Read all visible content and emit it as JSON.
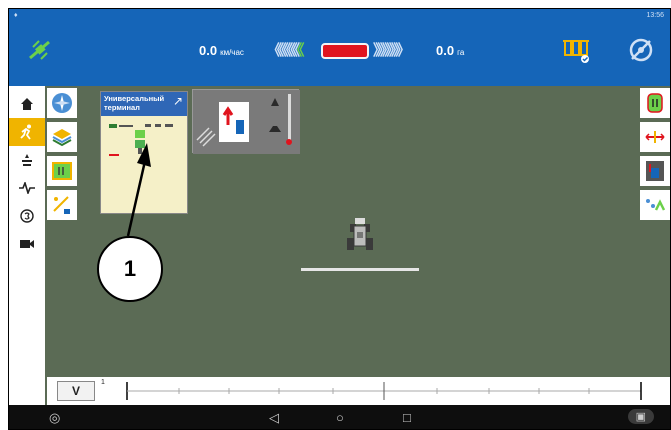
{
  "status_bar": {
    "left_icon": "signal-icon",
    "time": "13:56"
  },
  "top_bar": {
    "speed_left": {
      "value": "0.0",
      "unit": "км/час"
    },
    "speed_right": {
      "value": "0.0",
      "unit": "га"
    },
    "chevrons_left": "《《《《《",
    "chevrons_left_active": "《",
    "chevrons_right": "》》》》》》",
    "center_indicator_color": "#e0141e"
  },
  "left_nav": [
    {
      "name": "home-icon",
      "glyph": "🏠"
    },
    {
      "name": "run-icon",
      "glyph": "🏃"
    },
    {
      "name": "field-icon",
      "glyph": "⚘"
    },
    {
      "name": "pulse-icon",
      "glyph": "⚡"
    },
    {
      "name": "coin-icon",
      "glyph": "◎"
    },
    {
      "name": "camera-icon",
      "glyph": "■"
    }
  ],
  "universal_terminal": {
    "title": "Универсальный терминал"
  },
  "callout": {
    "number": "1"
  },
  "lightbar": {
    "v_label": "V",
    "number": "1"
  },
  "colors": {
    "accent": "#1565b8",
    "field": "#5b6b55",
    "active_nav": "#f0b400"
  }
}
